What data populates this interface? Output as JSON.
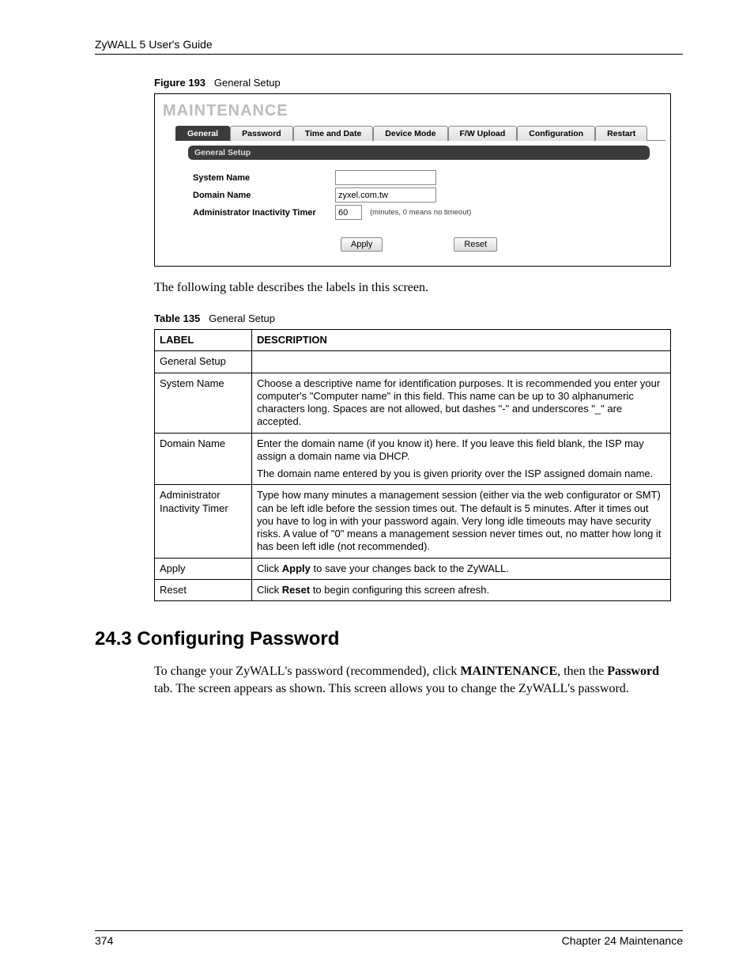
{
  "header": {
    "guide_title": "ZyWALL 5 User's Guide"
  },
  "figure": {
    "caption_bold": "Figure 193",
    "caption_text": "General Setup",
    "screen": {
      "title": "MAINTENANCE",
      "tabs": [
        {
          "label": "General",
          "active": true
        },
        {
          "label": "Password",
          "active": false
        },
        {
          "label": "Time and Date",
          "active": false
        },
        {
          "label": "Device Mode",
          "active": false
        },
        {
          "label": "F/W Upload",
          "active": false
        },
        {
          "label": "Configuration",
          "active": false
        },
        {
          "label": "Restart",
          "active": false
        }
      ],
      "section_label": "General Setup",
      "rows": {
        "system_name": {
          "label": "System Name",
          "value": ""
        },
        "domain_name": {
          "label": "Domain Name",
          "value": "zyxel.com.tw"
        },
        "admin_timer": {
          "label": "Administrator Inactivity Timer",
          "value": "60",
          "hint": "(minutes, 0 means no timeout)"
        }
      },
      "buttons": {
        "apply": "Apply",
        "reset": "Reset"
      }
    }
  },
  "intro_para": "The following table describes the labels in this screen.",
  "table": {
    "caption_bold": "Table 135",
    "caption_text": "General Setup",
    "headers": {
      "label": "LABEL",
      "description": "DESCRIPTION"
    },
    "rows": [
      {
        "label": "General Setup",
        "paras": [
          ""
        ]
      },
      {
        "label": "System Name",
        "paras": [
          "Choose a descriptive name for identification purposes. It is recommended you enter your computer's \"Computer name\" in this field. This name can be up to 30 alphanumeric characters long. Spaces are not allowed, but dashes \"-\" and underscores \"_\" are accepted."
        ]
      },
      {
        "label": "Domain Name",
        "paras": [
          "Enter the domain name (if you know it) here. If you leave this field blank, the ISP may assign a domain name via DHCP.",
          "The domain name entered by you is given priority over the ISP assigned domain name."
        ]
      },
      {
        "label": "Administrator Inactivity Timer",
        "paras": [
          "Type how many minutes a management session (either via the web configurator or SMT) can be left idle before the session times out. The default is 5 minutes. After it times out you have to log in with your password again. Very long idle timeouts may have security risks. A value of \"0\" means a management session never times out, no matter how long it has been left idle (not recommended)."
        ]
      },
      {
        "label": "Apply",
        "paras_html": "apply"
      },
      {
        "label": "Reset",
        "paras_html": "reset"
      }
    ],
    "apply_desc": {
      "pre": "Click ",
      "bold": "Apply",
      "post": " to save your changes back to the ZyWALL."
    },
    "reset_desc": {
      "pre": "Click ",
      "bold": "Reset",
      "post": " to begin configuring this screen afresh."
    }
  },
  "section_heading": "24.3  Configuring Password",
  "section_body": {
    "p1_pre": "To change your ZyWALL's password (recommended), click ",
    "p1_b1": "MAINTENANCE",
    "p1_mid": ", then the ",
    "p1_b2": "Password",
    "p1_post": " tab. The screen appears as shown. This screen allows you to change the ZyWALL's password."
  },
  "footer": {
    "page": "374",
    "chapter": "Chapter 24 Maintenance"
  }
}
